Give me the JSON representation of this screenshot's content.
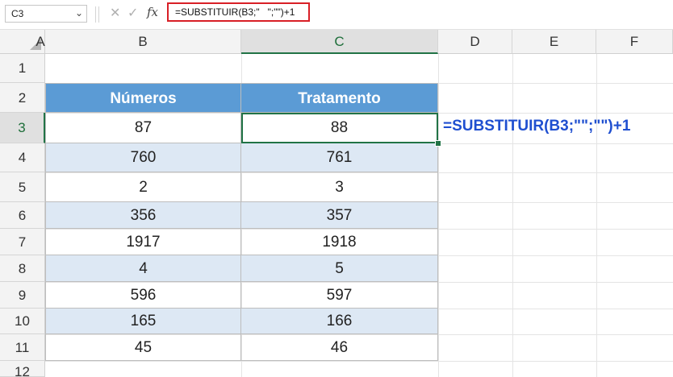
{
  "formula_bar": {
    "name_box": "C3",
    "name_box_arrow": "⌄",
    "cancel_icon": "✕",
    "enter_icon": "✓",
    "fx_label": "fx",
    "formula": "=SUBSTITUIR(B3;\"   \";\"\")+1"
  },
  "columns": [
    "A",
    "B",
    "C",
    "D",
    "E",
    "F"
  ],
  "rows": [
    "1",
    "2",
    "3",
    "4",
    "5",
    "6",
    "7",
    "8",
    "9",
    "10",
    "11",
    "12"
  ],
  "table": {
    "headers": [
      "Números",
      "Tratamento"
    ],
    "rows": [
      [
        "87",
        "88"
      ],
      [
        "760",
        "761"
      ],
      [
        "2",
        "3"
      ],
      [
        "356",
        "357"
      ],
      [
        "1917",
        "1918"
      ],
      [
        "4",
        "5"
      ],
      [
        "596",
        "597"
      ],
      [
        "165",
        "166"
      ],
      [
        "45",
        "46"
      ]
    ]
  },
  "annotation": "=SUBSTITUIR(B3;\"\";\"\")+1",
  "colors": {
    "header_fill": "#5b9bd5",
    "band_fill": "#dde8f4",
    "selection": "#217346",
    "annotation_text": "#1f4fd0",
    "formula_highlight": "#d81f26"
  }
}
